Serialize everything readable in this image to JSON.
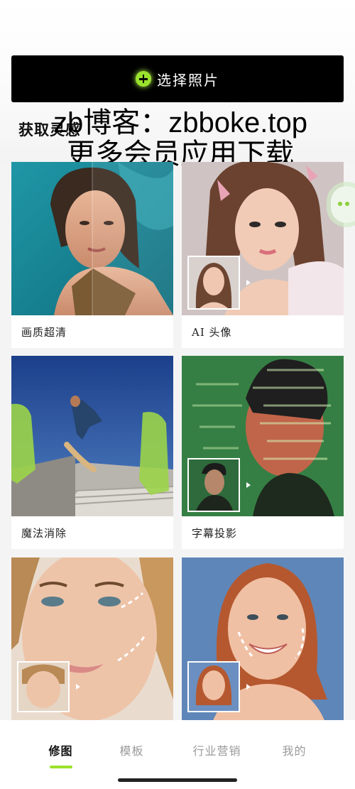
{
  "header": {
    "select_button_label": "选择照片",
    "section_title": "获取灵感"
  },
  "watermark": {
    "line1": "zb博客：zbboke.top",
    "line2": "更多会员应用下载"
  },
  "cards": [
    {
      "label": "画质超清",
      "icon": "photo-enhance"
    },
    {
      "label": "AI 头像",
      "icon": "ai-avatar"
    },
    {
      "label": "魔法消除",
      "icon": "magic-eraser"
    },
    {
      "label": "字幕投影",
      "icon": "caption-projection"
    },
    {
      "label": "",
      "icon": "face-slim"
    },
    {
      "label": "",
      "icon": "face-smile"
    }
  ],
  "nav": {
    "tabs": [
      {
        "label": "修图",
        "active": true
      },
      {
        "label": "模板",
        "active": false
      },
      {
        "label": "行业营销",
        "active": false
      },
      {
        "label": "我的",
        "active": false
      }
    ]
  },
  "colors": {
    "accent": "#9be22d",
    "button_bg": "#000000",
    "background": "#f4f4f4"
  }
}
